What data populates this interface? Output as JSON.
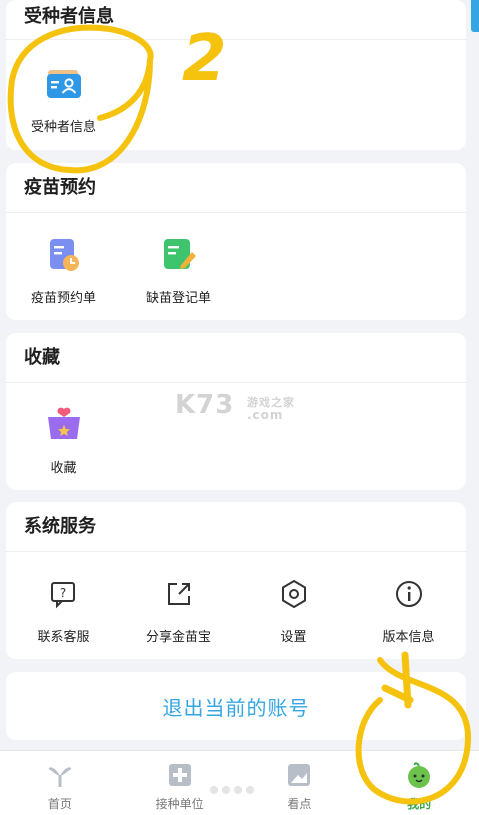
{
  "sections": {
    "info": {
      "title": "受种者信息",
      "items": [
        {
          "label": "受种者信息",
          "icon": "id-card-icon"
        }
      ]
    },
    "vaccine": {
      "title": "疫苗预约",
      "items": [
        {
          "label": "疫苗预约单",
          "icon": "appointment-doc-icon"
        },
        {
          "label": "缺苗登记单",
          "icon": "register-form-icon"
        }
      ]
    },
    "favorites": {
      "title": "收藏",
      "items": [
        {
          "label": "收藏",
          "icon": "favorites-box-icon"
        }
      ]
    },
    "system": {
      "title": "系统服务",
      "items": [
        {
          "label": "联系客服",
          "icon": "customer-service-icon"
        },
        {
          "label": "分享金苗宝",
          "icon": "share-icon"
        },
        {
          "label": "设置",
          "icon": "settings-icon"
        },
        {
          "label": "版本信息",
          "icon": "info-icon"
        }
      ]
    }
  },
  "logout": "退出当前的账号",
  "tabs": [
    {
      "label": "首页",
      "icon": "home-sprout-icon"
    },
    {
      "label": "接种单位",
      "icon": "clinic-icon"
    },
    {
      "label": "看点",
      "icon": "news-icon"
    },
    {
      "label": "我的",
      "icon": "profile-melon-icon",
      "active": true
    }
  ],
  "watermark": {
    "brand": "K73",
    "sub": "游戏之家",
    "domain": ".com"
  },
  "annotation": {
    "number": "2"
  },
  "colors": {
    "accent": "#36a6e3",
    "active_tab": "#3aa64a",
    "annotation": "#f5c30e"
  }
}
